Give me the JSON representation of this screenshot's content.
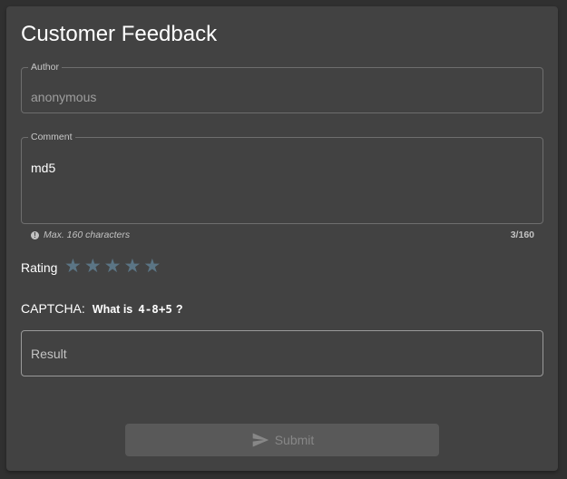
{
  "form": {
    "title": "Customer Feedback",
    "author": {
      "legend": "Author",
      "value": "anonymous"
    },
    "comment": {
      "legend": "Comment",
      "value": "md5",
      "hint": "Max. 160 characters",
      "counter": "3/160"
    },
    "rating": {
      "label": "Rating",
      "value": 0,
      "max": 5,
      "star_color": "#5b7585"
    },
    "captcha": {
      "label": "CAPTCHA:",
      "question": "What is",
      "expression": "4-8+5",
      "question_mark": "?"
    },
    "result": {
      "placeholder": "Result",
      "value": ""
    },
    "submit": {
      "label": "Submit",
      "icon": "send-icon",
      "disabled": true
    }
  }
}
